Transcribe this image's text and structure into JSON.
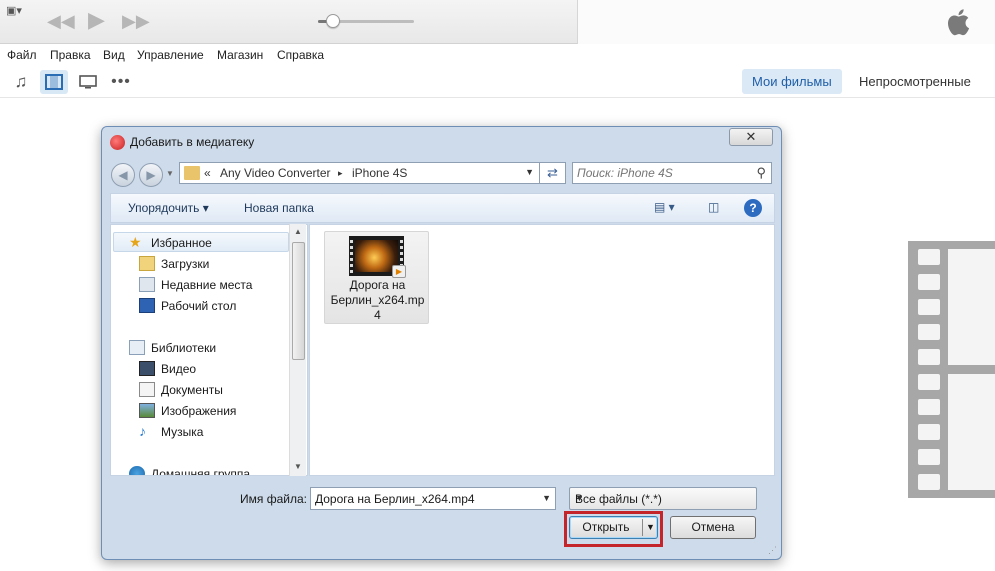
{
  "toolbar": {
    "sidebar_toggle_icon": "sidebar-toggle-icon",
    "rewind_icon": "rewind-icon",
    "play_icon": "play-icon",
    "fastforward_icon": "fastforward-icon",
    "volume_level": 0.15,
    "apple_logo": "apple-logo"
  },
  "menu": [
    "Файл",
    "Правка",
    "Вид",
    "Управление",
    "Магазин",
    "Справка"
  ],
  "media_icons": [
    "music-note-icon",
    "film-icon",
    "tv-icon",
    "more-dots-icon"
  ],
  "tabs": {
    "my_movies": "Мои фильмы",
    "unwatched": "Непросмотренные"
  },
  "dialog": {
    "title": "Добавить в медиатеку",
    "close_glyph": "✕",
    "address": {
      "prefix": "«",
      "part1": "Any Video Converter",
      "sep": "▸",
      "part2": "iPhone 4S"
    },
    "search_placeholder": "Поиск: iPhone 4S",
    "commands": {
      "organize": "Упорядочить ▾",
      "new_folder": "Новая папка"
    },
    "help_glyph": "?",
    "nav": {
      "favorites": "Избранное",
      "downloads": "Загрузки",
      "recent": "Недавние места",
      "desktop": "Рабочий стол",
      "libraries": "Библиотеки",
      "video": "Видео",
      "documents": "Документы",
      "pictures": "Изображения",
      "music": "Музыка",
      "homegroup": "Домашняя группа"
    },
    "file": {
      "name_line1": "Дорога на",
      "name_line2": "Берлин_x264.mp",
      "name_line3": "4"
    },
    "filename_label": "Имя файла:",
    "filename_value": "Дорога на Берлин_x264.mp4",
    "filter": "Все файлы (*.*)",
    "open_button": "Открыть",
    "cancel_button": "Отмена"
  }
}
